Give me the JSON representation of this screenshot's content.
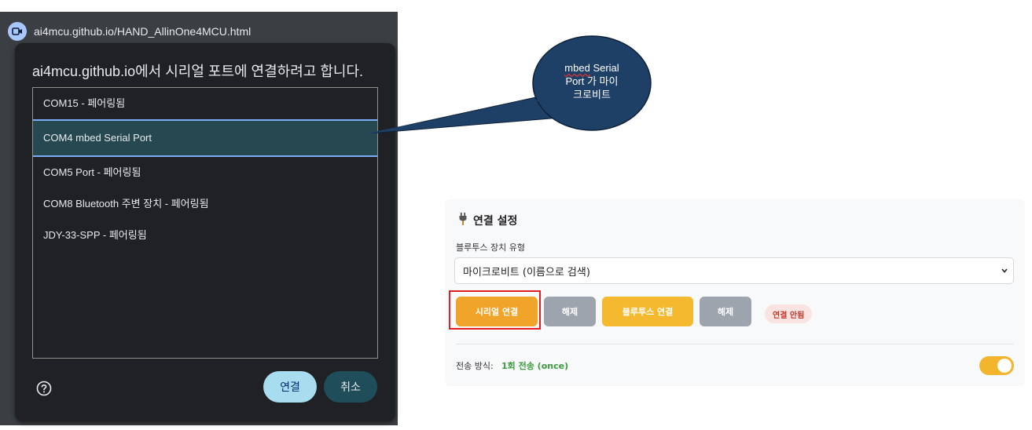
{
  "browser": {
    "url": "ai4mcu.github.io/HAND_AllinOne4MCU.html"
  },
  "serial_dialog": {
    "title": "ai4mcu.github.io에서 시리얼 포트에 연결하려고 합니다.",
    "ports": [
      {
        "label": "COM15 - 페어링됨"
      },
      {
        "label": "COM4 mbed Serial Port"
      },
      {
        "label": "COM5 Port - 페어링됨"
      },
      {
        "label": "COM8 Bluetooth 주변 장치 - 페어링됨"
      },
      {
        "label": "JDY-33-SPP - 페어링됨"
      }
    ],
    "selected_index": 1,
    "connect_label": "연결",
    "cancel_label": "취소"
  },
  "callout": {
    "line1_underlined": "mbed",
    "line1_rest": " Serial",
    "line2": "Port 가 마이",
    "line3": "크로비트",
    "fill_color": "#1e3f66"
  },
  "settings": {
    "title": "연결 설정",
    "device_type_label": "블루투스 장치 유형",
    "device_type_value": "마이크로비트 (이름으로 검색)",
    "serial_connect_label": "시리얼 연결",
    "serial_disconnect_label": "해제",
    "bt_connect_label": "블루투스 연결",
    "bt_disconnect_label": "해제",
    "status": "연결 안됨",
    "tx_mode_label": "전송 방식:",
    "tx_mode_value": "1회 전송 (once)",
    "tx_toggle_on": true
  },
  "colors": {
    "serial_button": "#f0a42a",
    "bt_button": "#f4b92e",
    "disconnect_button": "#9da4ad",
    "status_text": "#c0392b",
    "tx_value": "#3a9d3a",
    "highlight_box": "#e02020"
  }
}
